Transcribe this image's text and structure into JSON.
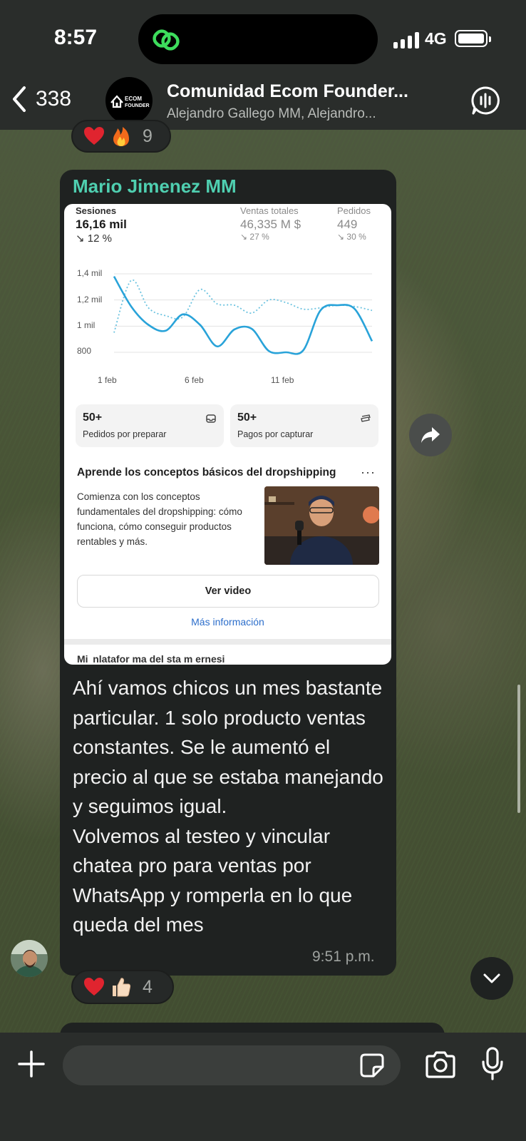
{
  "status_bar": {
    "time": "8:57",
    "network": "4G",
    "island_icon": "link-rings-icon"
  },
  "header": {
    "back_count": "338",
    "group_title": "Comunidad Ecom Founder...",
    "group_subtitle": "Alejandro Gallego MM, Alejandro...",
    "avatar_logo": "ECOM\nFOUNDERS",
    "icons": {
      "back": "chevron-left-icon",
      "call": "audio-call-icon"
    }
  },
  "top_reactions": {
    "emojis": [
      "red-heart",
      "fire"
    ],
    "count": "9"
  },
  "message": {
    "sender": "Mario Jimenez MM",
    "text": "Ahí vamos chicos un mes bastante particular. 1 solo producto ventas constantes. Se le aumentó el precio al que se estaba manejando y seguimos igual.\nVolvemos al testeo y vincular chatea pro para ventas por WhatsApp  y romperla en lo que queda del mes",
    "time": "9:51 p.m.",
    "reactions": {
      "emojis": [
        "red-heart",
        "thumbs-up"
      ],
      "count": "4"
    }
  },
  "screenshot": {
    "metrics": [
      {
        "label": "Sesiones",
        "value": "16,16 mil",
        "change": "↘ 12 %"
      },
      {
        "label": "Ventas totales",
        "value": "46,335 M $",
        "change": "↘ 27 %"
      },
      {
        "label": "Pedidos",
        "value": "449",
        "change": "↘ 30 %"
      }
    ],
    "cards": [
      {
        "number": "50+",
        "label": "Pedidos por preparar",
        "icon": "inbox-icon"
      },
      {
        "number": "50+",
        "label": "Pagos por capturar",
        "icon": "cash-icon"
      }
    ],
    "learn": {
      "title": "Aprende los conceptos básicos del dropshipping",
      "body": "Comienza con los conceptos fundamentales del dropshipping: cómo funciona, cómo conseguir productos rentables y más.",
      "video_button": "Ver video",
      "more_info": "Más información",
      "more_icon": "···"
    },
    "cut_text": "Mi  nlatafor ma del sta m ernesi"
  },
  "chart_data": {
    "type": "line",
    "x_tick_labels": [
      "1 feb",
      "6 feb",
      "11 feb"
    ],
    "y_tick_labels": [
      "1,4 mil",
      "1,2 mil",
      "1 mil",
      "800"
    ],
    "ylim": [
      800,
      1400
    ],
    "x": [
      1,
      2,
      3,
      4,
      5,
      6,
      7,
      8,
      9,
      10,
      11,
      12,
      13,
      14,
      15,
      16
    ],
    "series": [
      {
        "values": [
          1380,
          1150,
          1010,
          965,
          1090,
          1010,
          845,
          975,
          980,
          810,
          800,
          815,
          1120,
          1160,
          1130,
          885
        ],
        "color": "#29a3d9",
        "style": "solid"
      },
      {
        "values": [
          950,
          1350,
          1140,
          1080,
          1070,
          1280,
          1170,
          1160,
          1100,
          1200,
          1180,
          1130,
          1140,
          1160,
          1150,
          1120
        ],
        "color": "#6cc3e0",
        "style": "dotted"
      }
    ],
    "grid": true
  },
  "composer": {
    "placeholder": "",
    "icons": {
      "plus": "plus-icon",
      "sticker": "sticker-icon",
      "camera": "camera-icon",
      "mic": "microphone-icon"
    }
  },
  "colors": {
    "sender": "#4fcfb0",
    "bubble": "#1f2221",
    "bars": "#2a2d2b",
    "link": "#2c6ecb"
  }
}
